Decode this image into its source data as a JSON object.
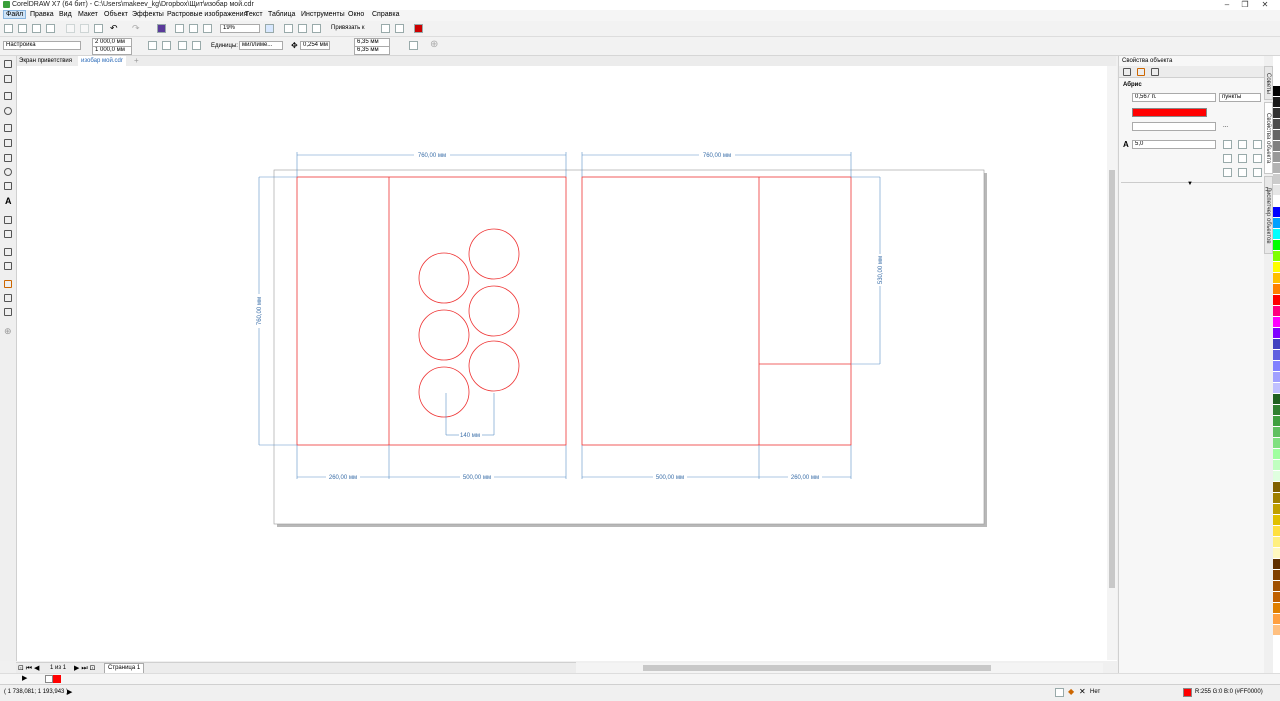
{
  "window": {
    "title": "CorelDRAW X7 (64 бит) - C:\\Users\\makeev_kg\\Dropbox\\Щит\\изобар мой.cdr"
  },
  "menu": [
    "Файл",
    "Правка",
    "Вид",
    "Макет",
    "Объект",
    "Эффекты",
    "Растровые изображения",
    "Текст",
    "Таблица",
    "Инструменты",
    "Окно",
    "Справка"
  ],
  "toolbar": {
    "zoom": "19%",
    "snap_label": "Привязать к"
  },
  "propbar": {
    "preset": "Настройка",
    "width": "2 000,0 мм",
    "height": "1 000,0 мм",
    "units_label": "Единицы:",
    "units_value": "миллиме...",
    "nudge": "0,254 мм",
    "dup_x": "6,35 мм",
    "dup_y": "6,35 мм"
  },
  "tabs": [
    "Экран приветствия",
    "изобар мой.cdr"
  ],
  "drawing": {
    "dim_760_left": "760,00 мм",
    "dim_760_right": "760,00 мм",
    "dim_760_vertical": "760,00 мм",
    "dim_530": "530,00 мм",
    "dim_140": "140 мм",
    "dim_260_left": "260,00 мм",
    "dim_500_left": "500,00 мм",
    "dim_500_right": "500,00 мм",
    "dim_260_right": "260,00 мм"
  },
  "panel": {
    "title": "Свойства объекта",
    "section": "Абрис",
    "outline_width": "0,567 п.",
    "outline_units": "пункты",
    "outline_color": "#FF0000",
    "miter": "5,0",
    "more": "..."
  },
  "side_tabs": [
    "Советы",
    "Свойства объекта",
    "Диспетчер объектов"
  ],
  "pagenav": {
    "page_count": "1 из 1",
    "page_tab": "Страница 1"
  },
  "status": {
    "coords": "( 1 738,081; 1 193,943 )",
    "fill_label": "Нет",
    "outline_color_text": "R:255 G:0 B:0 (#FF0000)"
  },
  "palette_colors": [
    "#000000",
    "#1a1a1a",
    "#333333",
    "#4d4d4d",
    "#666666",
    "#808080",
    "#999999",
    "#b3b3b3",
    "#cccccc",
    "#e6e6e6",
    "#ffffff",
    "#0000ff",
    "#00a0ff",
    "#00ffff",
    "#00ff00",
    "#80ff00",
    "#ffff00",
    "#ffc000",
    "#ff8000",
    "#ff0000",
    "#ff0080",
    "#ff00ff",
    "#8000ff",
    "#4040c0",
    "#6060e0",
    "#8080ff",
    "#a0a0ff",
    "#c0c0ff",
    "#206020",
    "#308030",
    "#40a040",
    "#60c060",
    "#80e080",
    "#a0ffa0",
    "#c0ffc0",
    "#e0ffe0",
    "#806000",
    "#a08000",
    "#c0a000",
    "#e0c000",
    "#ffe040",
    "#fff080",
    "#fff8c0",
    "#603000",
    "#804000",
    "#a05000",
    "#c06000",
    "#e08000",
    "#ffa040",
    "#ffc080"
  ]
}
